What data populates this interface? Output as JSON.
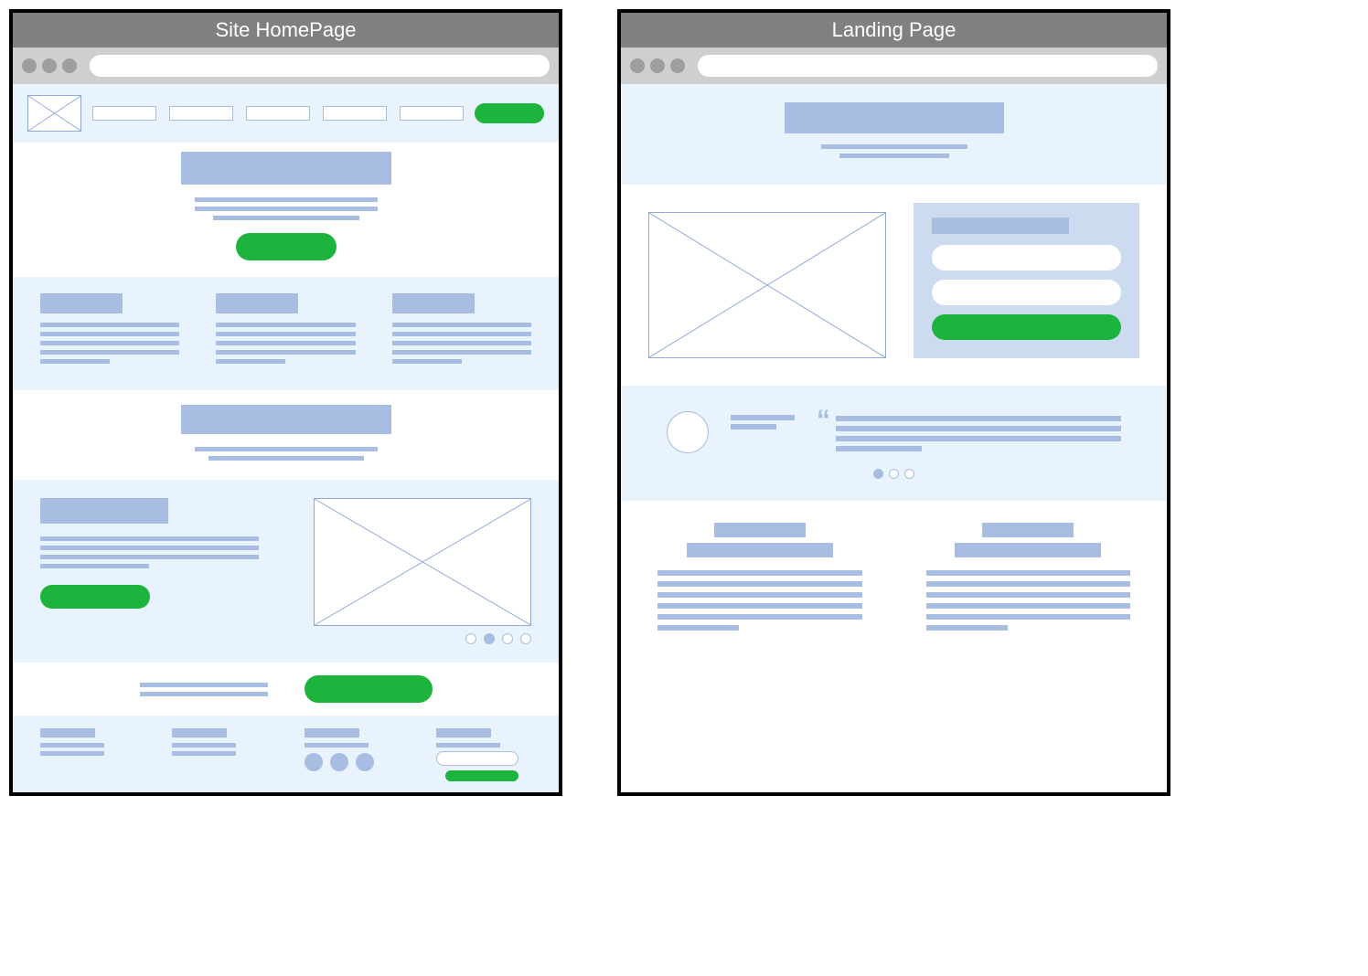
{
  "homepage": {
    "title": "Site HomePage"
  },
  "landing": {
    "title": "Landing Page"
  }
}
